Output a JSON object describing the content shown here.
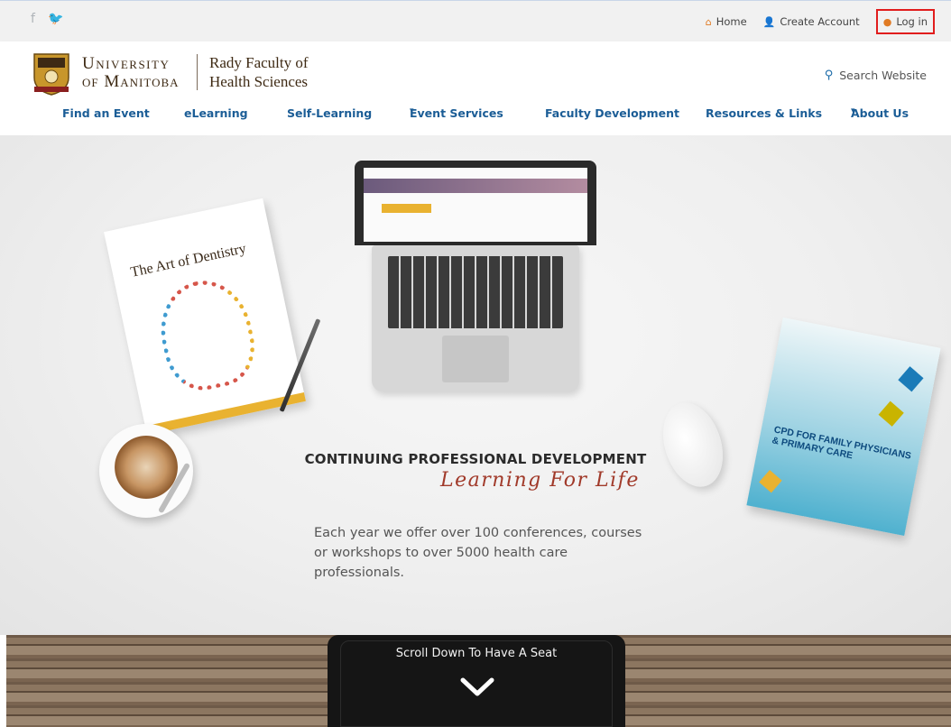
{
  "topbar": {
    "social": [
      {
        "icon": "facebook-icon",
        "glyph": "f"
      },
      {
        "icon": "twitter-icon",
        "glyph": "🐦"
      }
    ],
    "links": {
      "home": "Home",
      "create_account": "Create Account",
      "login": "Log in"
    }
  },
  "header": {
    "university_line1": "University",
    "university_line2": "of Manitoba",
    "faculty_line1": "Rady Faculty of",
    "faculty_line2": "Health Sciences",
    "search_label": "Search Website"
  },
  "nav": {
    "items": [
      {
        "label": "Find an Event",
        "dropdown": false
      },
      {
        "label": "eLearning",
        "dropdown": false
      },
      {
        "label": "Self-Learning",
        "dropdown": false
      },
      {
        "label": "Event Services",
        "dropdown": true
      },
      {
        "label": "Faculty Development",
        "dropdown": false
      },
      {
        "label": "Resources & Links",
        "dropdown": false
      },
      {
        "label": "About Us",
        "dropdown": true
      }
    ],
    "caret": "▾"
  },
  "hero": {
    "heading": "CONTINUING PROFESSIONAL DEVELOPMENT",
    "tagline": "Learning For Life",
    "description": "Each year we offer over 100 conferences, courses or workshops to over 5000 health care professionals.",
    "brochure_left_title": "The Art of Dentistry",
    "brochure_right_title": "CPD FOR FAMILY PHYSICIANS & PRIMARY CARE"
  },
  "scroll": {
    "label": "Scroll Down To Have A Seat"
  },
  "colors": {
    "nav_blue": "#1b5d96",
    "accent_orange": "#e07a23",
    "login_highlight": "#e11d1d",
    "tagline_red": "#a13a2a"
  }
}
